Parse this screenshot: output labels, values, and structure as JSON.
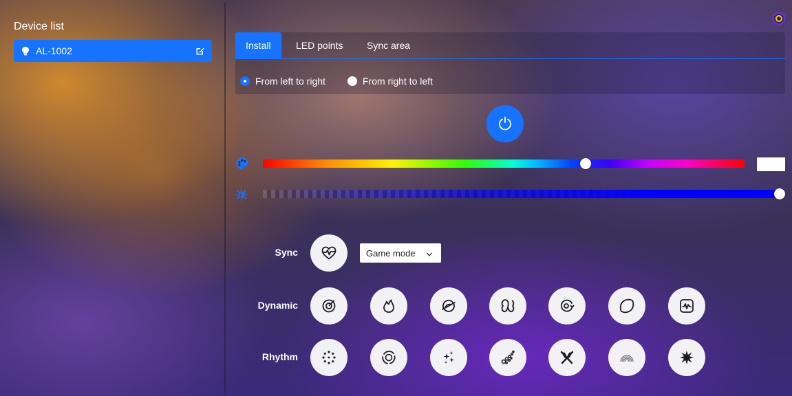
{
  "sidebar": {
    "title": "Device list",
    "devices": [
      {
        "name": "AL-1002",
        "icon": "bulb-icon",
        "selected": true
      }
    ]
  },
  "tabs": [
    {
      "label": "Install",
      "active": true
    },
    {
      "label": "LED points",
      "active": false
    },
    {
      "label": "Sync area",
      "active": false
    }
  ],
  "direction": {
    "options": [
      {
        "label": "From left to right",
        "selected": true
      },
      {
        "label": "From right to left",
        "selected": false
      }
    ]
  },
  "color": {
    "hue_fraction": 0.67,
    "swatch": "#ffffff"
  },
  "brightness": {
    "fraction": 1.0
  },
  "sync": {
    "label": "Sync",
    "mode_select": "Game mode",
    "icon": "heart-pulse-icon"
  },
  "dynamic": {
    "label": "Dynamic",
    "icons": [
      "swirl-target-icon",
      "flame-icon",
      "orbit-icon",
      "loop-icon",
      "spin-icon",
      "lemon-icon",
      "waveform-icon"
    ]
  },
  "rhythm": {
    "label": "Rhythm",
    "icons": [
      "dot-ring-icon",
      "circle-swirl-icon",
      "sparkles-icon",
      "bubbles-icon",
      "crossed-sticks-icon",
      "rainbow-icon",
      "burst-icon"
    ]
  },
  "colors": {
    "accent": "#1673ff",
    "button_bg": "#f2f2f4"
  }
}
